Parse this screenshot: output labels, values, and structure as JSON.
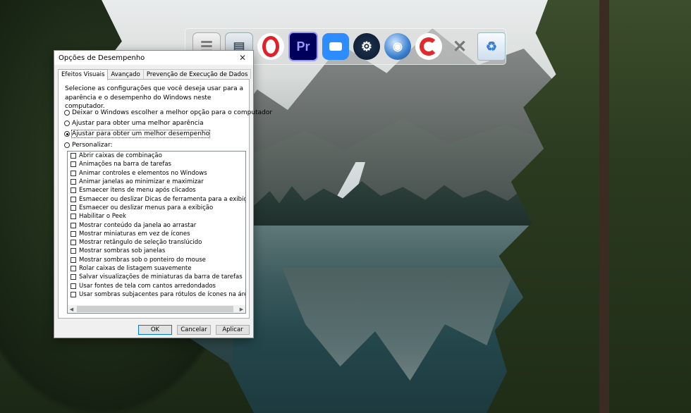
{
  "dock": {
    "icons": [
      "document-icon",
      "folder-document-icon",
      "opera-icon",
      "premiere-pro-icon",
      "zoom-icon",
      "steam-icon",
      "browser-globe-icon",
      "ccleaner-icon",
      "tools-icon",
      "recycle-bin-icon"
    ],
    "pr_label": "Pr"
  },
  "dialog": {
    "title": "Opções de Desempenho",
    "tabs": [
      {
        "label": "Efeitos Visuais",
        "active": true
      },
      {
        "label": "Avançado",
        "active": false
      },
      {
        "label": "Prevenção de Execução de Dados",
        "active": false
      }
    ],
    "description": "Selecione as configurações que você deseja usar para a aparência e o desempenho do Windows neste computador.",
    "radios": [
      {
        "label": "Deixar o Windows escolher a melhor opção para o computador",
        "checked": false
      },
      {
        "label": "Ajustar para obter uma melhor aparência",
        "checked": false
      },
      {
        "label": "Ajustar para obter um melhor desempenho",
        "checked": true
      },
      {
        "label": "Personalizar:",
        "checked": false
      }
    ],
    "options": [
      "Abrir caixas de combinação",
      "Animações na barra de tarefas",
      "Animar controles e elementos no Windows",
      "Animar janelas ao minimizar e maximizar",
      "Esmaecer itens de menu após clicados",
      "Esmaecer ou deslizar Dicas de ferramenta para a exibição",
      "Esmaecer ou deslizar menus para a exibição",
      "Habilitar o Peek",
      "Mostrar conteúdo da janela ao arrastar",
      "Mostrar miniaturas em vez de ícones",
      "Mostrar retângulo de seleção translúcido",
      "Mostrar sombras sob janelas",
      "Mostrar sombras sob o ponteiro do mouse",
      "Rolar caixas de listagem suavemente",
      "Salvar visualizações de miniaturas da barra de tarefas",
      "Usar fontes de tela com cantos arredondados",
      "Usar sombras subjacentes para rótulos de ícones na área de trabalho"
    ],
    "buttons": {
      "ok": "OK",
      "cancel": "Cancelar",
      "apply": "Aplicar"
    }
  }
}
